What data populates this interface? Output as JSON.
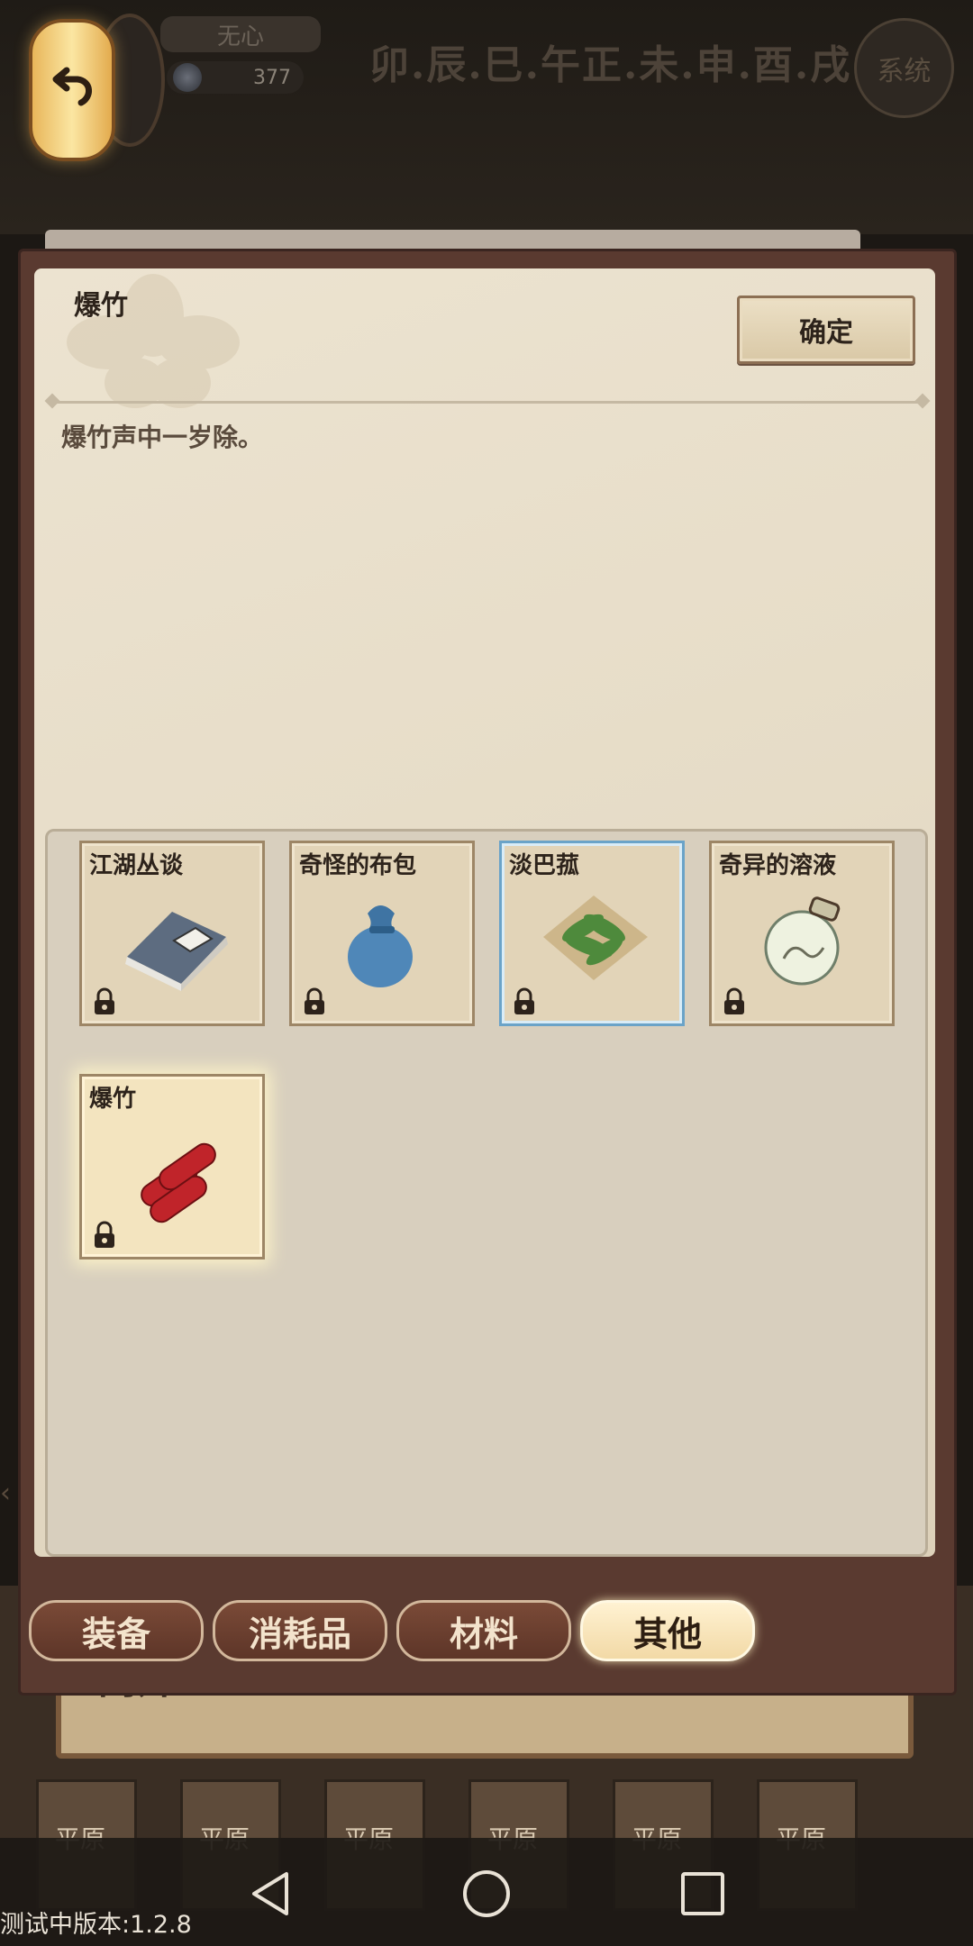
{
  "top_bar": {
    "player_name": "无心",
    "currency_value": "377",
    "time_periods": "卯.辰.巳.午正.未.申.酉.戌",
    "system_label": "系统"
  },
  "dialog": {
    "item_title": "爆竹",
    "confirm_label": "确定",
    "item_description": "爆竹声中一岁除。"
  },
  "inventory": {
    "slots": [
      {
        "name": "江湖丛谈",
        "icon": "book-icon",
        "locked": true
      },
      {
        "name": "奇怪的布包",
        "icon": "cloth-bag-icon",
        "locked": true
      },
      {
        "name": "淡巴菰",
        "icon": "tobacco-leaf-icon",
        "locked": true,
        "state": "selected"
      },
      {
        "name": "奇异的溶液",
        "icon": "potion-bottle-icon",
        "locked": true
      },
      {
        "name": "爆竹",
        "icon": "firecracker-icon",
        "locked": true,
        "state": "active"
      }
    ]
  },
  "tabs": [
    {
      "label": "装备",
      "active": false
    },
    {
      "label": "消耗品",
      "active": false
    },
    {
      "label": "材料",
      "active": false
    },
    {
      "label": "其他",
      "active": true
    }
  ],
  "background": {
    "leave_label": "离开",
    "map_label": "平原"
  },
  "version_text": "测试中版本:1.2.8",
  "colors": {
    "frame": "#5a3a30",
    "parchment": "#e6dcc7",
    "tab_active": "#f2d9a6",
    "slot_selected_border": "#6aa3c8"
  }
}
